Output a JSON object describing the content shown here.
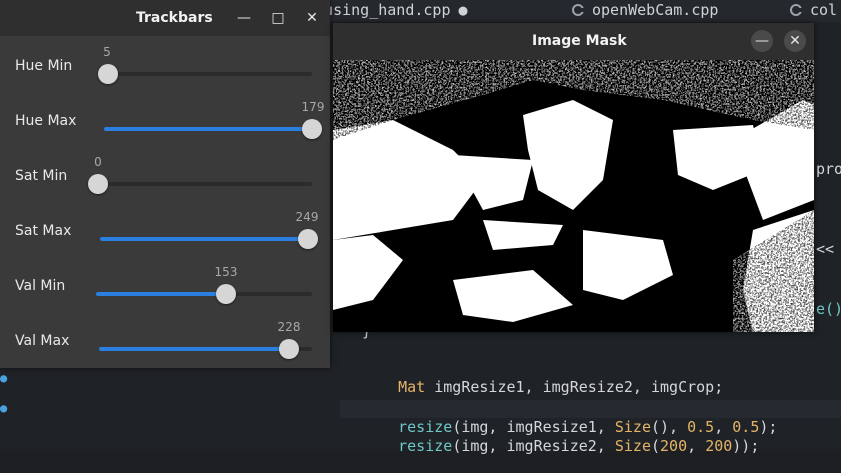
{
  "editor": {
    "tabs": [
      {
        "label": "w_using_hand.cpp",
        "modified": "●"
      },
      {
        "label": "openWebCam.cpp"
      },
      {
        "label": "col"
      }
    ],
    "code": {
      "line1_type": "Mat",
      "line1_rest": " imgResize1, imgResize2, imgCrop;",
      "line2_fn": "resize",
      "line2_a": "(img, imgResize1, ",
      "line2_type": "Size",
      "line2_b": "(), ",
      "line2_n1": "0.5",
      "line2_c": ", ",
      "line2_n2": "0.5",
      "line2_d": ");",
      "line3_fn": "resize",
      "line3_a": "(img, imgResize2, ",
      "line3_type": "Size",
      "line3_b": "(",
      "line3_n1": "200",
      "line3_c": ", ",
      "line3_n2": "200",
      "line3_d": "));",
      "fragment_pro": "pro",
      "fragment_lt": "<<",
      "fragment_paren": "e()",
      "fragment_brace": "}"
    }
  },
  "trackbars": {
    "title": "Trackbars",
    "controls": [
      {
        "label": "Hue Min",
        "value": "5",
        "fraction": 0.02
      },
      {
        "label": "Hue Max",
        "value": "179",
        "fraction": 1.0
      },
      {
        "label": "Sat Min",
        "value": "0",
        "fraction": 0.0
      },
      {
        "label": "Sat Max",
        "value": "249",
        "fraction": 0.98
      },
      {
        "label": "Val Min",
        "value": "153",
        "fraction": 0.6
      },
      {
        "label": "Val Max",
        "value": "228",
        "fraction": 0.89
      }
    ]
  },
  "mask_window": {
    "title": "Image Mask"
  },
  "colors": {
    "accent": "#2a7fe0",
    "mask_bg": "#000000",
    "mask_fg": "#ffffff"
  }
}
